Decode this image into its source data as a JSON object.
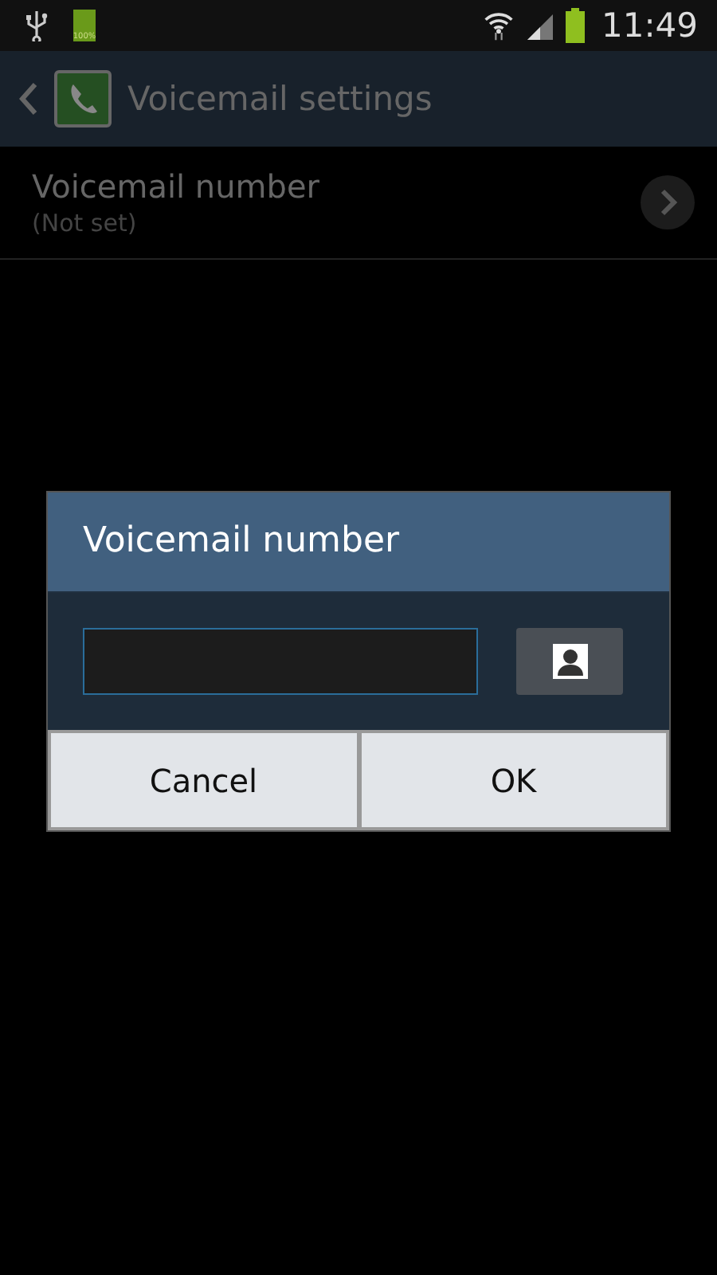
{
  "status_bar": {
    "battery_label": "100%",
    "time": "11:49"
  },
  "action_bar": {
    "title": "Voicemail settings"
  },
  "settings": [
    {
      "title": "Voicemail number",
      "summary": "(Not set)"
    }
  ],
  "dialog": {
    "title": "Voicemail number",
    "field": {
      "focused": true
    },
    "buttons": [
      {
        "label": "Cancel"
      },
      {
        "label": "OK"
      }
    ]
  }
}
